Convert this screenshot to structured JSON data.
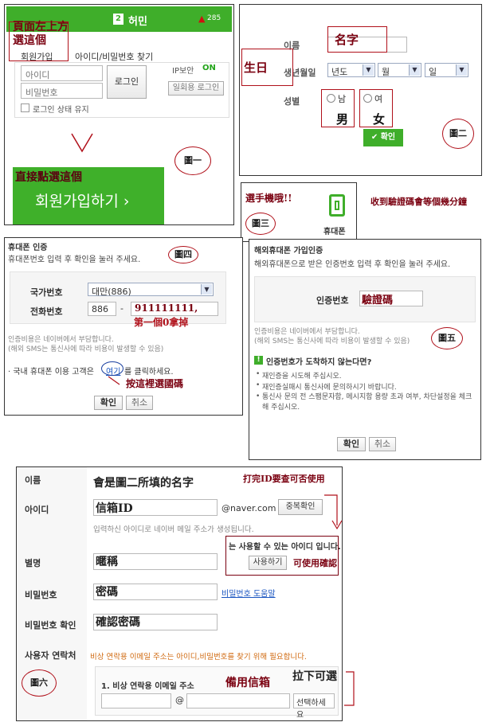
{
  "fig1": {
    "header_num": "2",
    "header_name": "허민",
    "header_count": "285",
    "signup_link": "회원가입",
    "find_link": "아이디/비밀번호 찾기",
    "id_placeholder": "아이디",
    "pw_placeholder": "비밀번호",
    "login_button": "로그인",
    "keep_login": "로그인 상태 유지",
    "ip_security": "IP보안",
    "ip_on": "ON",
    "one_time_login": "일회용 로그인",
    "signup_big": "회원가입하기 ›",
    "note_top": "頁面左上方選這個",
    "note_bottom": "直接點選這個",
    "label": "圖一"
  },
  "fig2": {
    "name_label": "이름",
    "name_value": "名字",
    "birth_label": "생년월일",
    "birth_note": "生日",
    "year": "년도",
    "month": "월",
    "day": "일",
    "gender_label": "성별",
    "male": "남",
    "female": "여",
    "male_note": "男",
    "female_note": "女",
    "confirm": "✔ 확인",
    "label": "圖二"
  },
  "fig3": {
    "note": "選手機哦!!",
    "icon_label": "휴대폰",
    "side_note": "收到驗證碼會等個幾分鐘",
    "label": "圖三"
  },
  "fig4": {
    "title": "휴대폰 인증",
    "desc": "휴대폰번호 입력 후 확인을 눌러 주세요.",
    "country_label": "국가번호",
    "country_value": "대만(886)",
    "phone_label": "전화번호",
    "phone_prefix": "886",
    "dash": "-",
    "phone_value": "911111111,",
    "phone_note": "第一個0拿掉",
    "fee_line1": "인증비용은 네이버에서 부담합니다.",
    "fee_line2": "(해외 SMS는 통신사에 따라 비용이 발생할 수 있음)",
    "domestic": "· 국내 휴대폰 이용 고객은",
    "here": "여기",
    "click_suffix": "를 클릭하세요.",
    "here_note": "按這裡選國碼",
    "ok": "확인",
    "cancel": "취소",
    "label": "圖四"
  },
  "fig5": {
    "title": "해외휴대폰 가입인증",
    "desc": "해외휴대폰으로 받은 인증번호 입력 후 확인을 눌러 주세요.",
    "code_label": "인증번호",
    "code_value": "驗證碼",
    "fee_line1": "인증비용은 네이버에서 부담합니다.",
    "fee_line2": "(해외 SMS는 통신사에 따라 비용이 발생할 수 있음)",
    "not_arrived": "인증번호가 도착하지 않는다면?",
    "bullet1": "재인증을 시도해 주십시오.",
    "bullet2": "재인증실패시 통신사에 문의하시기 바랍니다.",
    "bullet3": "통신사 문의 전 스팸문자함, 메시지함 용량 초과 여부, 차단설정을 체크해 주십시오.",
    "ok": "확인",
    "cancel": "취소",
    "label": "圖五"
  },
  "fig6": {
    "name_label": "이름",
    "name_value": "會是圖二所填的名字",
    "id_label": "아이디",
    "id_value": "信箱ID",
    "domain": "@naver.com",
    "dup_check": "중복확인",
    "id_note": "打完ID要查可否使用",
    "id_help": "입력하신 아이디로 네이버 메일 주소가 생성됩니다.",
    "available_msg": "는 사용할 수 있는 아이디 입니다.",
    "use_button": "사용하기",
    "use_note": "可使用確認",
    "nick_label": "별명",
    "nick_value": "暱稱",
    "pw_label": "비밀번호",
    "pw_value": "密碼",
    "pw_help": "비밀번호 도움말",
    "pw_confirm_label": "비밀번호 확인",
    "pw_confirm_value": "確認密碼",
    "contact_label": "사용자 연락처",
    "contact_notice": "비상 연락용 이메일 주소는 아이디,비밀번호를 찾기 위해 필요합니다.",
    "email_label": "1. 비상 연락용 이메일 주소",
    "email_note": "備用信箱",
    "dropdown_note": "拉下可選",
    "at": "@",
    "select_default": "선택하세요",
    "label": "圖六"
  }
}
